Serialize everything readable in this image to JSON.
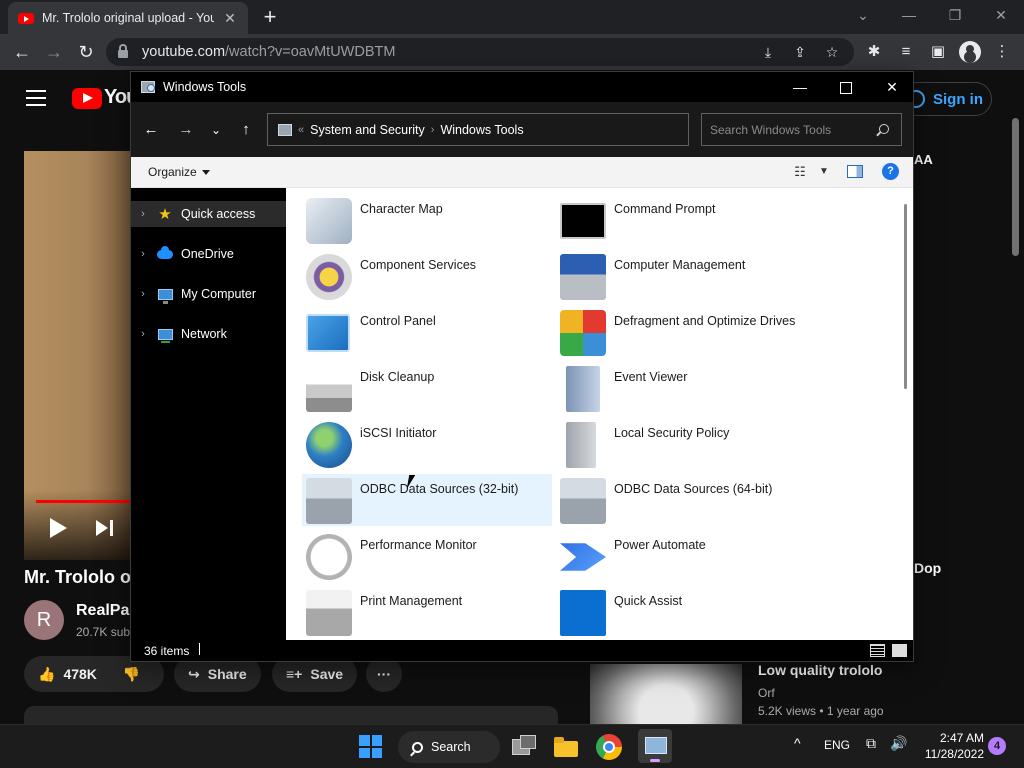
{
  "browser": {
    "tab_title": "Mr. Trololo original upload - You",
    "url_host": "youtube.com",
    "url_path": "/watch?v=oavMtUWDBTM"
  },
  "youtube": {
    "logo_text": "You",
    "signin_label": "Sign in",
    "video_title": "Mr. Trololo o",
    "channel_initial": "R",
    "channel_name": "RealPap",
    "channel_subs": "20.7K sub",
    "like_count": "478K",
    "share_label": "Share",
    "save_label": "Save",
    "more_label": "···",
    "side_text_top": "AA",
    "side_text_mid": "Dop",
    "rec_title": "Low quality trololo",
    "rec_channel": "Orf",
    "rec_meta": "5.2K views • 1 year ago"
  },
  "explorer": {
    "window_title": "Windows Tools",
    "breadcrumb_prefix": "«",
    "breadcrumb": [
      "System and Security",
      "Windows Tools"
    ],
    "breadcrumb_sep": "›",
    "search_placeholder": "Search Windows Tools",
    "organize_label": "Organize",
    "help_label": "?",
    "nav_items": [
      {
        "label": "Quick access"
      },
      {
        "label": "OneDrive"
      },
      {
        "label": "My Computer"
      },
      {
        "label": "Network"
      }
    ],
    "items": [
      {
        "label": "Character Map",
        "icon": "character-map-icon"
      },
      {
        "label": "Command Prompt",
        "icon": "command-prompt-icon"
      },
      {
        "label": "Component Services",
        "icon": "component-services-icon"
      },
      {
        "label": "Computer Management",
        "icon": "computer-management-icon"
      },
      {
        "label": "Control Panel",
        "icon": "control-panel-icon"
      },
      {
        "label": "Defragment and Optimize Drives",
        "icon": "defragment-icon"
      },
      {
        "label": "Disk Cleanup",
        "icon": "disk-cleanup-icon"
      },
      {
        "label": "Event Viewer",
        "icon": "event-viewer-icon"
      },
      {
        "label": "iSCSI Initiator",
        "icon": "iscsi-initiator-icon"
      },
      {
        "label": "Local Security Policy",
        "icon": "local-security-policy-icon"
      },
      {
        "label": "ODBC Data Sources (32-bit)",
        "icon": "odbc-32-icon"
      },
      {
        "label": "ODBC Data Sources (64-bit)",
        "icon": "odbc-64-icon"
      },
      {
        "label": "Performance Monitor",
        "icon": "performance-monitor-icon"
      },
      {
        "label": "Power Automate",
        "icon": "power-automate-icon"
      },
      {
        "label": "Print Management",
        "icon": "print-management-icon"
      },
      {
        "label": "Quick Assist",
        "icon": "quick-assist-icon"
      }
    ],
    "status_count": "36 items"
  },
  "taskbar": {
    "search_label": "Search",
    "language": "ENG",
    "time": "2:47 AM",
    "date": "11/28/2022",
    "notification_count": "4"
  }
}
